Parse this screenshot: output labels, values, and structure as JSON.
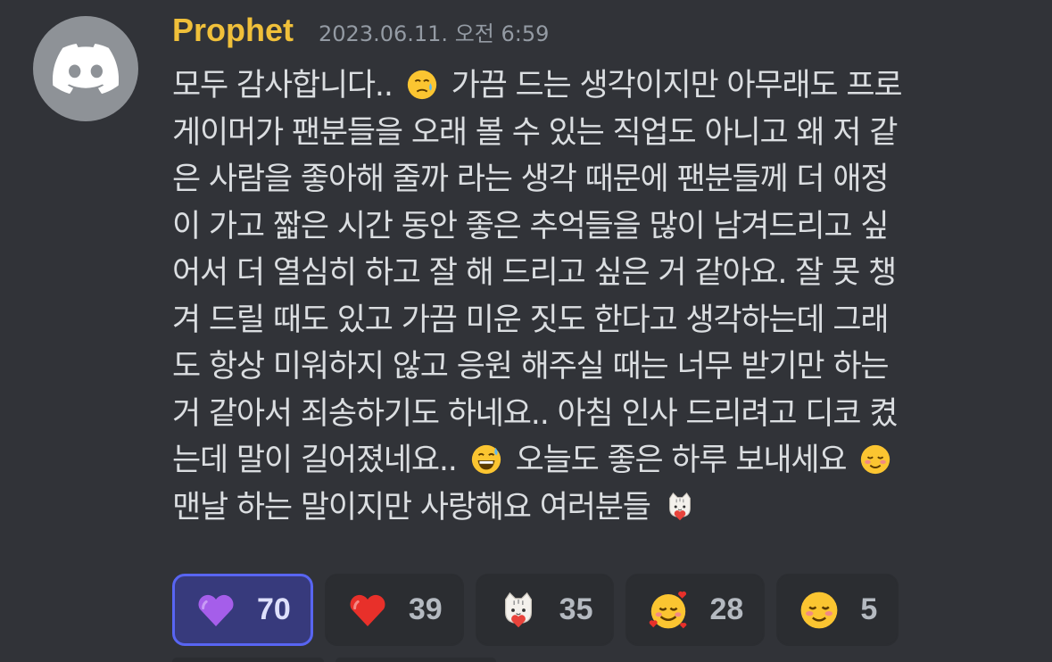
{
  "author": {
    "name": "Prophet",
    "timestamp": "2023.06.11. 오전 6:59",
    "avatar_icon": "discord-logo-icon",
    "name_color": "#f0c03a"
  },
  "message": {
    "lines": [
      {
        "segments": [
          {
            "text": "모두 감사합니다.. "
          },
          {
            "emoji": "face-holding-back-tears-icon"
          },
          {
            "text": " 가끔 드는 생각이지만 아무래도 프로"
          }
        ]
      },
      {
        "segments": [
          {
            "text": "게이머가 팬분들을 오래 볼 수 있는 직업도 아니고 왜 저 같"
          }
        ]
      },
      {
        "segments": [
          {
            "text": "은 사람을 좋아해 줄까 라는 생각 때문에 팬분들께 더 애정"
          }
        ]
      },
      {
        "segments": [
          {
            "text": "이 가고 짧은 시간 동안 좋은 추억들을 많이 남겨드리고 싶"
          }
        ]
      },
      {
        "segments": [
          {
            "text": "어서 더 열심히 하고 잘 해 드리고 싶은 거 같아요. 잘 못 챙"
          }
        ]
      },
      {
        "segments": [
          {
            "text": "겨 드릴 때도 있고 가끔 미운 짓도 한다고 생각하는데 그래"
          }
        ]
      },
      {
        "segments": [
          {
            "text": "도 항상 미워하지 않고 응원 해주실 때는 너무 받기만 하는"
          }
        ]
      },
      {
        "segments": [
          {
            "text": "거 같아서 죄송하기도 하네요.. 아침 인사 드리려고 디코 켰"
          }
        ]
      },
      {
        "segments": [
          {
            "text": "는데 말이 길어졌네요.. "
          },
          {
            "emoji": "grinning-sweat-icon"
          },
          {
            "text": " 오늘도 좋은 하루 보내세요 "
          },
          {
            "emoji": "smiling-blush-icon"
          }
        ]
      },
      {
        "segments": [
          {
            "text": "맨날 하는 말이지만 사랑해요 여러분들 "
          },
          {
            "emoji": "cat-heart-sticker-icon"
          }
        ]
      }
    ]
  },
  "reactions": [
    {
      "emoji": "purple-heart-icon",
      "count": "70",
      "me": true
    },
    {
      "emoji": "red-heart-icon",
      "count": "39",
      "me": false
    },
    {
      "emoji": "cat-heart-sticker-icon",
      "count": "35",
      "me": false
    },
    {
      "emoji": "smiling-face-with-hearts-icon",
      "count": "28",
      "me": false
    },
    {
      "emoji": "smiling-blush-icon",
      "count": "5",
      "me": false
    }
  ],
  "colors": {
    "background": "#313338",
    "reaction_bg": "#2b2d31",
    "reaction_selected_bg": "#373a7c",
    "reaction_selected_border": "#5865f2"
  }
}
